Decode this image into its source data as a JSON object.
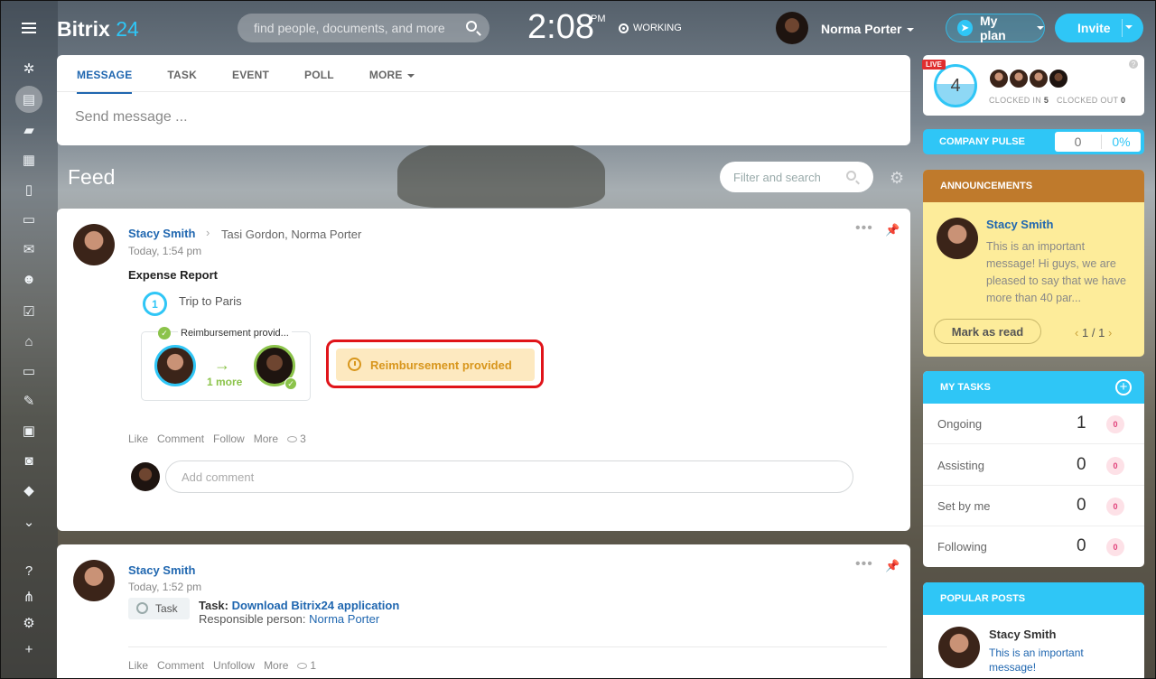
{
  "header": {
    "logo_text": "Bitrix",
    "logo_num": "24",
    "search_placeholder": "find people, documents, and more",
    "clock": "2:08",
    "ampm": "PM",
    "status": "WORKING",
    "user_name": "Norma Porter",
    "myplan_label": "My plan",
    "invite_label": "Invite"
  },
  "composer": {
    "tabs": [
      "MESSAGE",
      "TASK",
      "EVENT",
      "POLL",
      "MORE"
    ],
    "placeholder": "Send message ..."
  },
  "feed": {
    "title": "Feed",
    "filter_placeholder": "Filter and search"
  },
  "post1": {
    "author": "Stacy Smith",
    "recipients": "Tasi Gordon, Norma Porter",
    "time": "Today, 1:54 pm",
    "title": "Expense Report",
    "stage_number": "1",
    "trip": "Trip to Paris",
    "approval_label": "Reimbursement provid...",
    "more_label": "1 more",
    "status_label": "Reimbursement provided",
    "actions": [
      "Like",
      "Comment",
      "Follow",
      "More"
    ],
    "views": "3",
    "comment_placeholder": "Add comment"
  },
  "post2": {
    "author": "Stacy Smith",
    "time": "Today, 1:52 pm",
    "badge": "Task",
    "task_prefix": "Task:",
    "task_link": "Download Bitrix24 application",
    "resp_prefix": "Responsible person:",
    "resp_link": "Norma Porter",
    "actions": [
      "Like",
      "Comment",
      "Unfollow",
      "More"
    ],
    "views": "1"
  },
  "timeman": {
    "live": "LIVE",
    "count": "4",
    "clocked_in_label": "CLOCKED IN",
    "clocked_in": "5",
    "clocked_out_label": "CLOCKED OUT",
    "clocked_out": "0"
  },
  "pulse": {
    "label": "COMPANY PULSE",
    "value": "0",
    "percent": "0%"
  },
  "announcements": {
    "title": "ANNOUNCEMENTS",
    "author": "Stacy Smith",
    "text": "This is an important message! Hi guys, we are pleased to say that we have more than 40 par...",
    "button": "Mark as read",
    "page_current": "1",
    "page_sep": "/",
    "page_total": "1"
  },
  "tasks": {
    "title": "MY TASKS",
    "rows": [
      {
        "label": "Ongoing",
        "count": "1",
        "badge": "0"
      },
      {
        "label": "Assisting",
        "count": "0",
        "badge": "0"
      },
      {
        "label": "Set by me",
        "count": "0",
        "badge": "0"
      },
      {
        "label": "Following",
        "count": "0",
        "badge": "0"
      }
    ]
  },
  "popular": {
    "title": "POPULAR POSTS",
    "author": "Stacy Smith",
    "text": "This is an important message!"
  },
  "colors": {
    "accent": "#2fc6f6",
    "link": "#2067b0",
    "highlight": "#e0141a",
    "announcement_header": "#bf7a2c"
  }
}
